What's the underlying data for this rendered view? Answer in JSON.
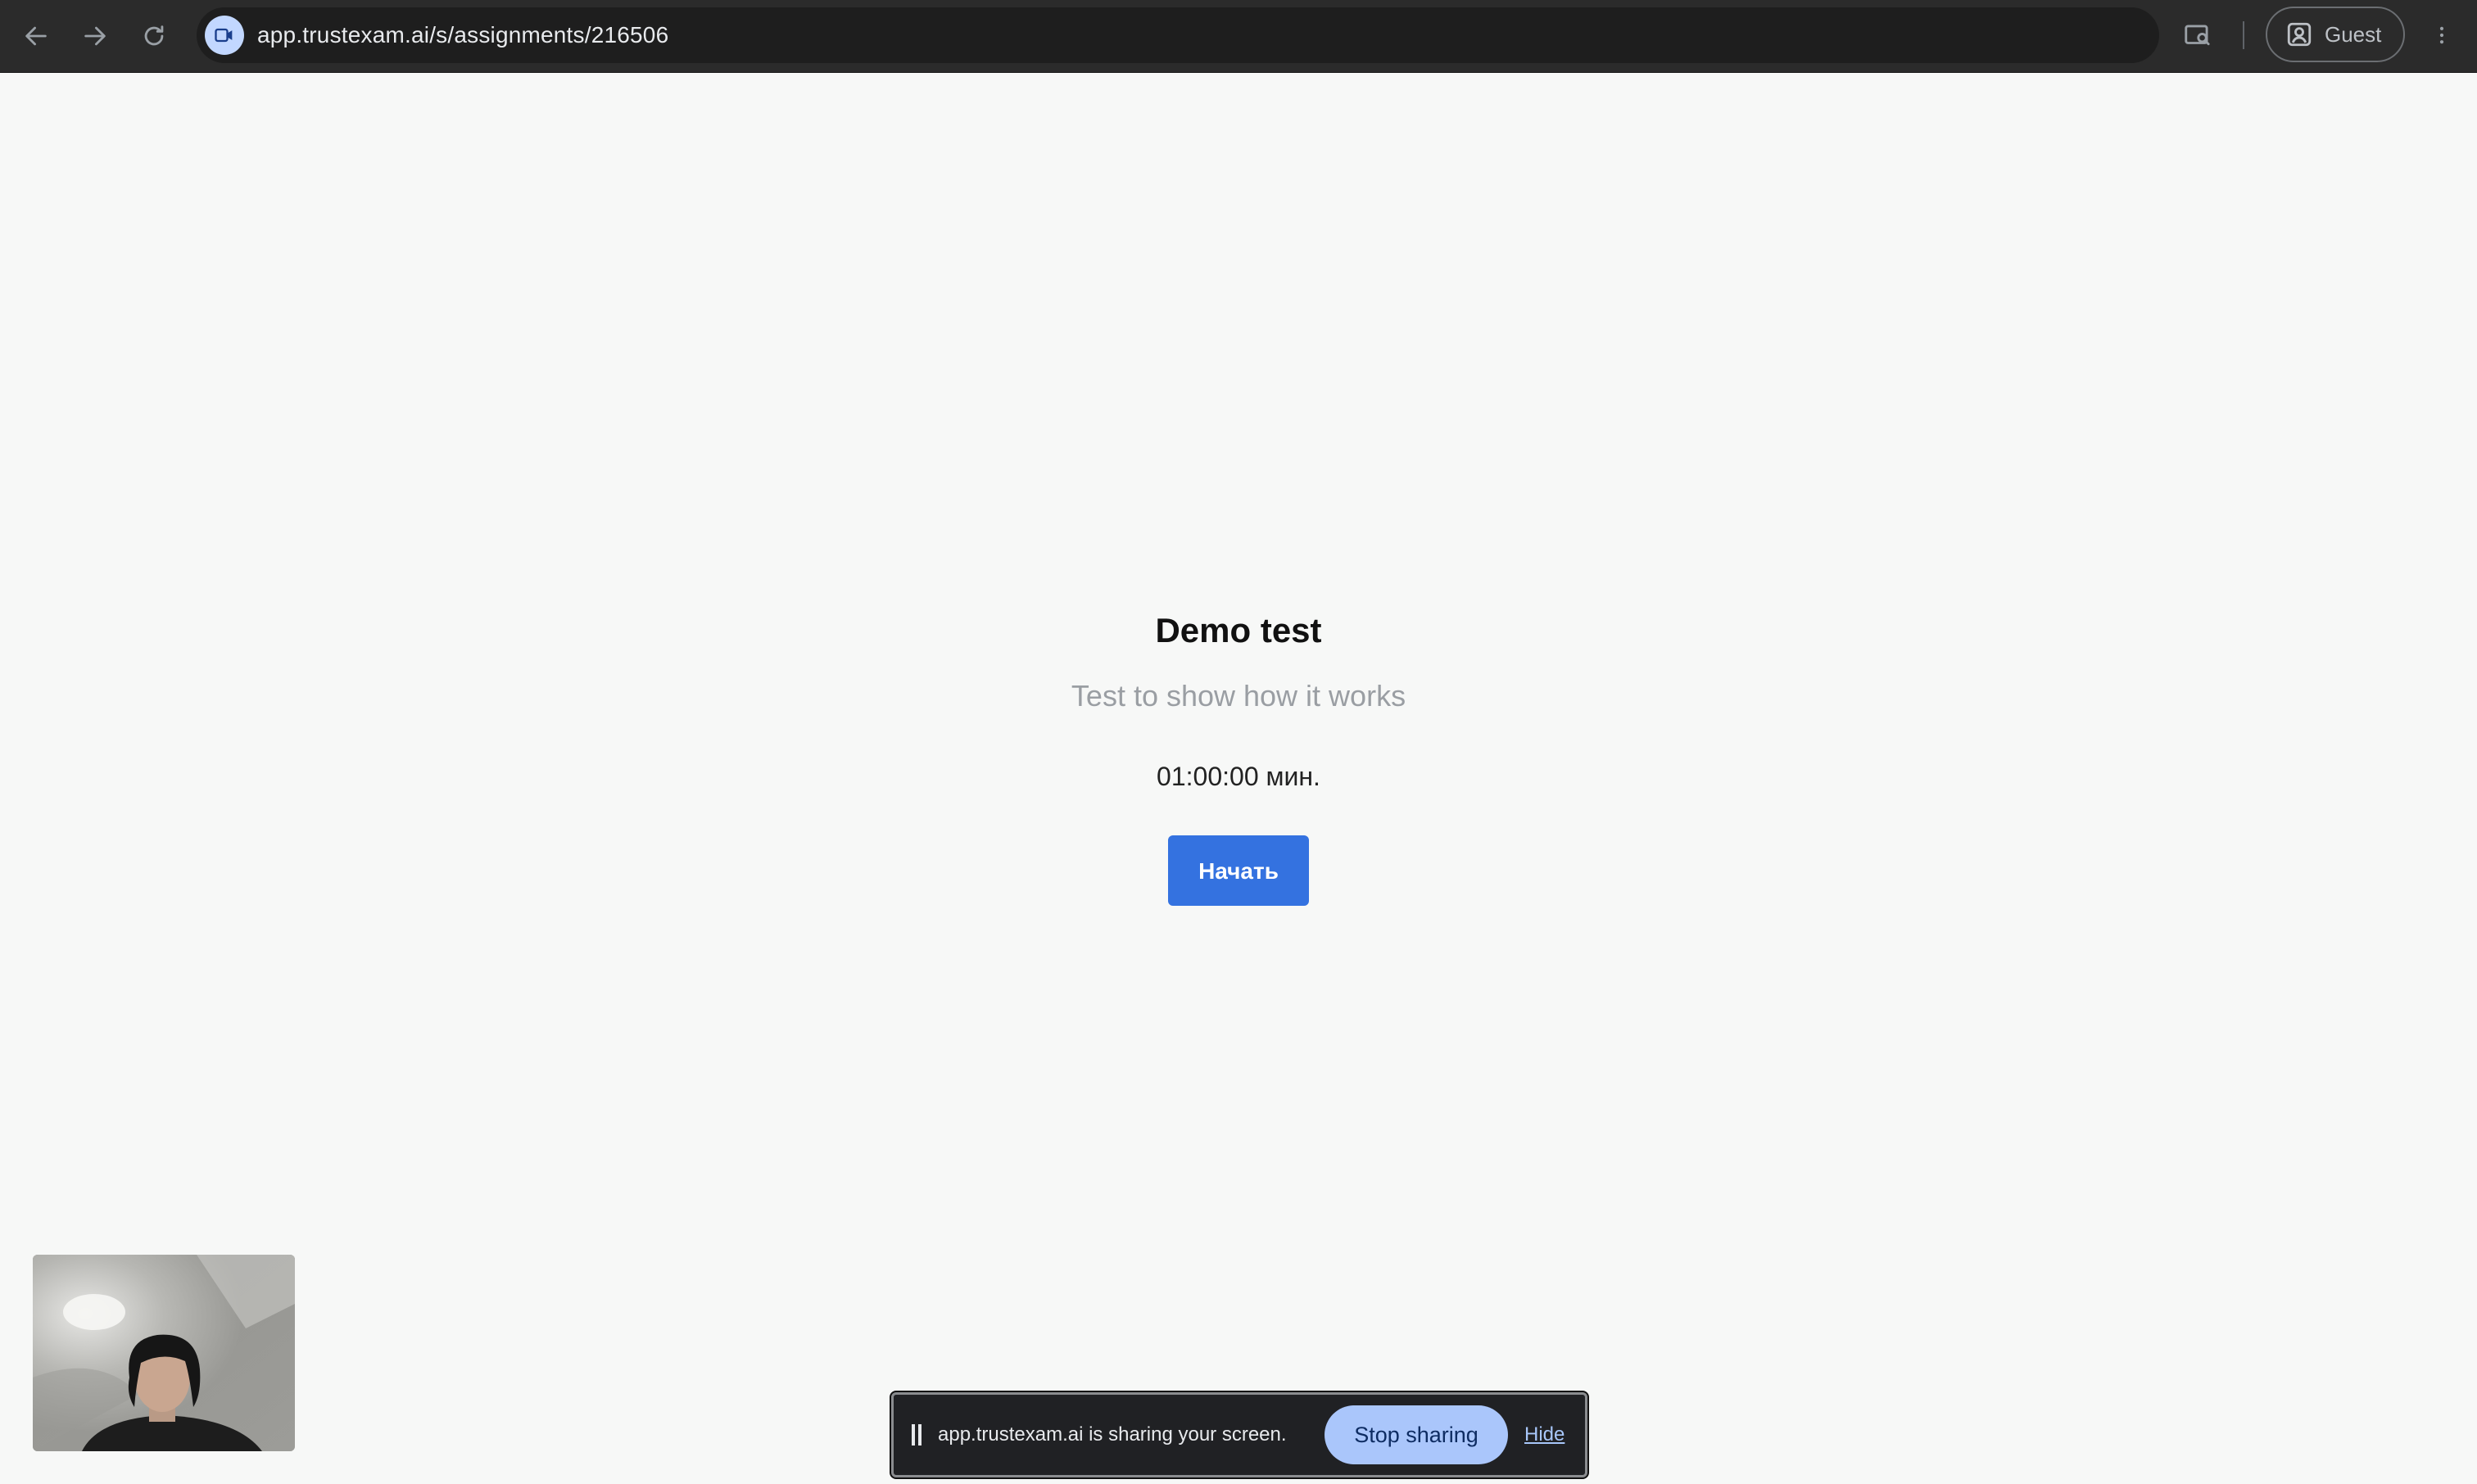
{
  "browser": {
    "url": "app.trustexam.ai/s/assignments/216506",
    "profile_label": "Guest",
    "icons": {
      "back": "arrow-left-icon",
      "forward": "arrow-right-icon",
      "reload": "reload-icon",
      "site_info": "camera-icon",
      "search_tab": "search-tab-icon",
      "profile": "person-icon",
      "menu": "kebab-menu-icon"
    }
  },
  "assignment": {
    "title": "Demo test",
    "subtitle": "Test to show how it works",
    "duration": "01:00:00 мин.",
    "start_label": "Начать"
  },
  "screen_share": {
    "message": "app.trustexam.ai is sharing your screen.",
    "stop_label": "Stop sharing",
    "hide_label": "Hide"
  },
  "colors": {
    "page_background": "#f7f8f7",
    "primary_button": "#3472e0",
    "toolbar": "#2b2b2b",
    "stop_button": "#aac6fb"
  }
}
